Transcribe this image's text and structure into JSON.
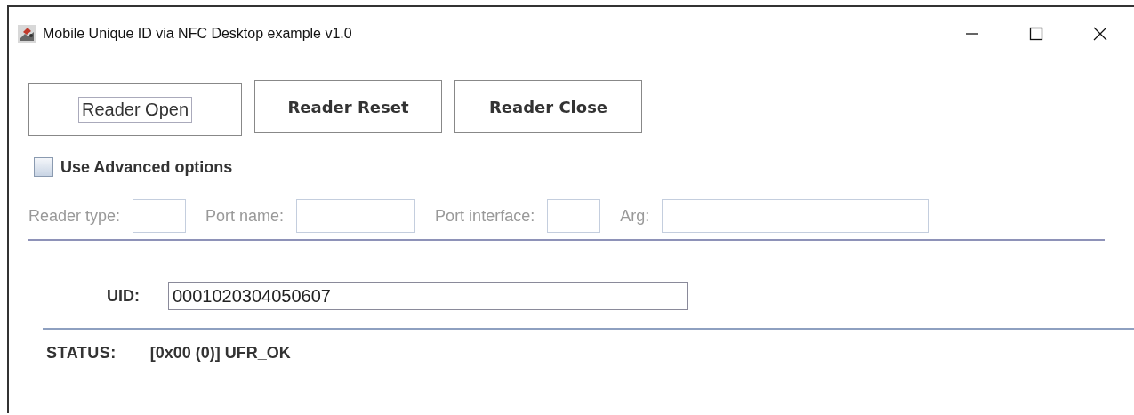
{
  "window": {
    "title": "Mobile Unique ID via NFC Desktop example v1.0"
  },
  "buttons": [
    {
      "label": "Reader Open",
      "focused": true
    },
    {
      "label": "Reader Reset",
      "focused": false
    },
    {
      "label": "Reader Close",
      "focused": false
    }
  ],
  "advanced": {
    "label": "Use Advanced options",
    "checked": false
  },
  "advanced_fields": [
    {
      "label": "Reader type:",
      "disabled": true
    },
    {
      "label": "Port name:",
      "disabled": true
    },
    {
      "label": "Port interface:",
      "disabled": true
    },
    {
      "label": "Arg:",
      "disabled": true
    }
  ],
  "uid": {
    "label": "UID:",
    "value": "0001020304050607"
  },
  "status": {
    "label": "STATUS:",
    "value": "[0x00 (0)] UFR_OK"
  }
}
